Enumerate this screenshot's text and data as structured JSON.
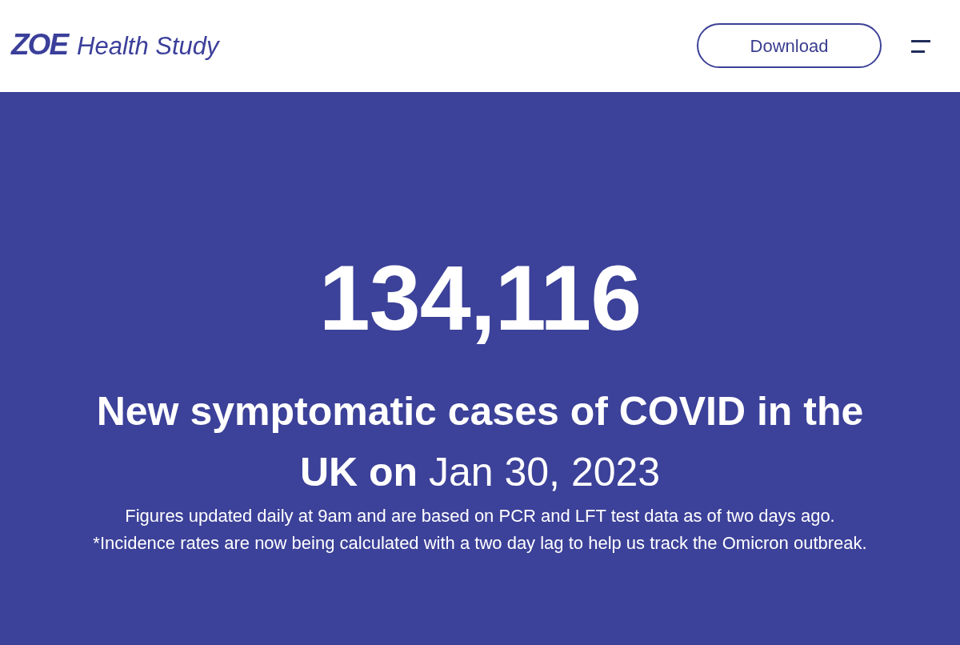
{
  "header": {
    "logo": {
      "mark": "ZOE",
      "name": "Health Study"
    },
    "download_button": "Download"
  },
  "hero": {
    "case_count": "134,116",
    "headline": "**New symptomatic cases of COVID in the UK on** Jan 30, 2023",
    "notes": [
      "Figures updated daily at 9am and are based on PCR and LFT test data as of two days ago.",
      "*Incidence rates are now being calculated with a two day lag to help us track the Omicron outbreak."
    ]
  }
}
